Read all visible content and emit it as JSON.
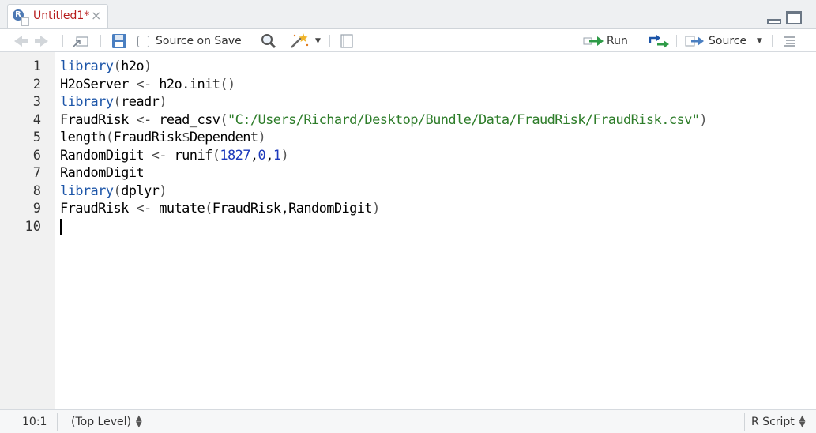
{
  "tab": {
    "title": "Untitled1*",
    "close": "×"
  },
  "toolbar": {
    "source_on_save": "Source on Save",
    "run": "Run",
    "source": "Source"
  },
  "editor": {
    "line_numbers": [
      "1",
      "2",
      "3",
      "4",
      "5",
      "6",
      "7",
      "8",
      "9",
      "10"
    ],
    "lines": [
      [
        {
          "t": "library",
          "c": "kw"
        },
        {
          "t": "(",
          "c": "punc"
        },
        {
          "t": "h2o",
          "c": ""
        },
        {
          "t": ")",
          "c": "punc"
        }
      ],
      [
        {
          "t": "H2oServer ",
          "c": ""
        },
        {
          "t": "<-",
          "c": "op"
        },
        {
          "t": " h2o.init",
          "c": ""
        },
        {
          "t": "()",
          "c": "punc"
        }
      ],
      [
        {
          "t": "library",
          "c": "kw"
        },
        {
          "t": "(",
          "c": "punc"
        },
        {
          "t": "readr",
          "c": ""
        },
        {
          "t": ")",
          "c": "punc"
        }
      ],
      [
        {
          "t": "FraudRisk ",
          "c": ""
        },
        {
          "t": "<-",
          "c": "op"
        },
        {
          "t": " read_csv",
          "c": ""
        },
        {
          "t": "(",
          "c": "punc"
        },
        {
          "t": "\"C:/Users/Richard/Desktop/Bundle/Data/FraudRisk/FraudRisk.csv\"",
          "c": "str"
        },
        {
          "t": ")",
          "c": "punc"
        }
      ],
      [
        {
          "t": "length",
          "c": ""
        },
        {
          "t": "(",
          "c": "punc"
        },
        {
          "t": "FraudRisk",
          "c": ""
        },
        {
          "t": "$",
          "c": "op"
        },
        {
          "t": "Dependent",
          "c": ""
        },
        {
          "t": ")",
          "c": "punc"
        }
      ],
      [
        {
          "t": "RandomDigit ",
          "c": ""
        },
        {
          "t": "<-",
          "c": "op"
        },
        {
          "t": " runif",
          "c": ""
        },
        {
          "t": "(",
          "c": "punc"
        },
        {
          "t": "1827",
          "c": "num"
        },
        {
          "t": ",",
          "c": ""
        },
        {
          "t": "0",
          "c": "num"
        },
        {
          "t": ",",
          "c": ""
        },
        {
          "t": "1",
          "c": "num"
        },
        {
          "t": ")",
          "c": "punc"
        }
      ],
      [
        {
          "t": "RandomDigit",
          "c": ""
        }
      ],
      [
        {
          "t": "library",
          "c": "kw"
        },
        {
          "t": "(",
          "c": "punc"
        },
        {
          "t": "dplyr",
          "c": ""
        },
        {
          "t": ")",
          "c": "punc"
        }
      ],
      [
        {
          "t": "FraudRisk ",
          "c": ""
        },
        {
          "t": "<-",
          "c": "op"
        },
        {
          "t": " mutate",
          "c": ""
        },
        {
          "t": "(",
          "c": "punc"
        },
        {
          "t": "FraudRisk,RandomDigit",
          "c": ""
        },
        {
          "t": ")",
          "c": "punc"
        }
      ],
      []
    ],
    "cursor_line": 10
  },
  "status": {
    "position": "10:1",
    "scope": "(Top Level)",
    "file_type": "R Script"
  },
  "colors": {
    "keyword": "#1c55a8",
    "string": "#2e7d2a",
    "number": "#1c39bb",
    "tab_title_modified": "#b71c1c"
  }
}
